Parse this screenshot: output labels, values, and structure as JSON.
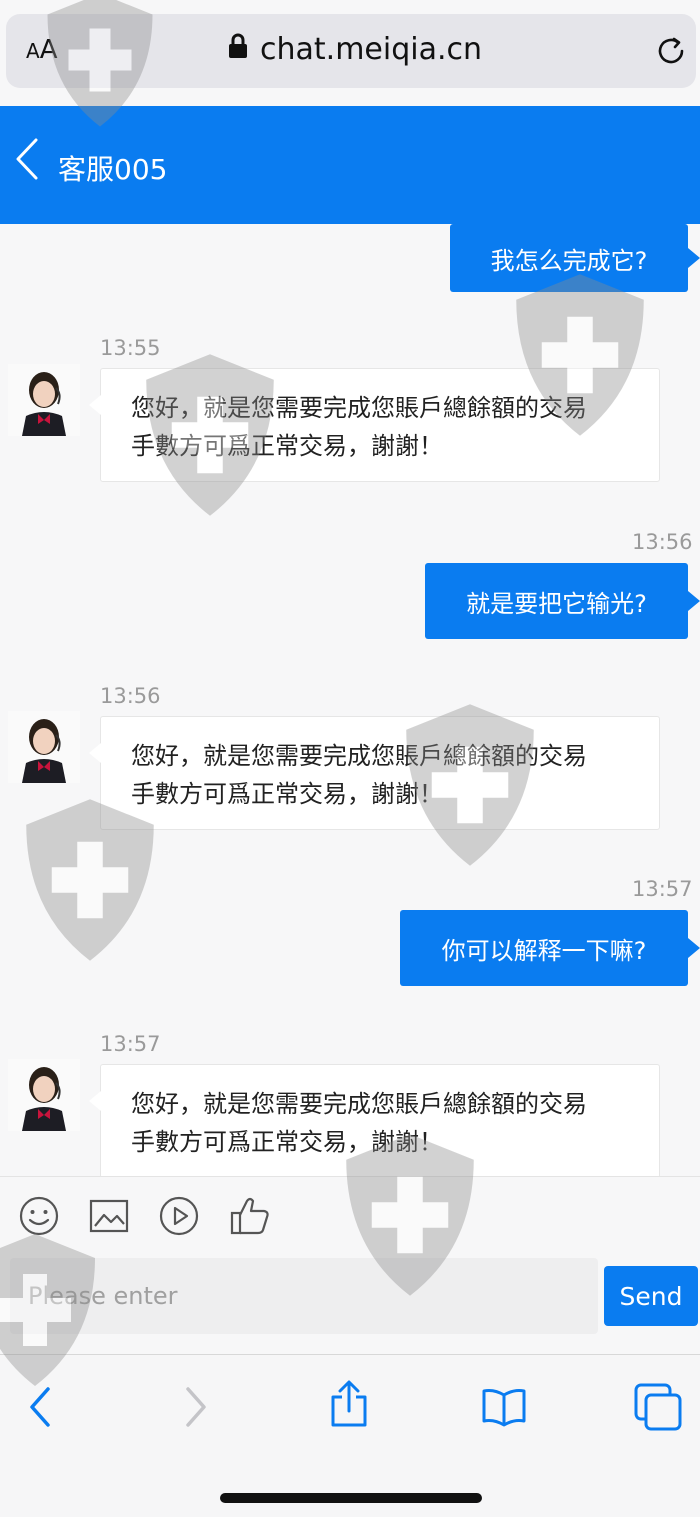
{
  "browser": {
    "text_size_label_small": "A",
    "text_size_label_large": "A",
    "url": "chat.meiqia.cn"
  },
  "header": {
    "title": "客服005"
  },
  "messages": [
    {
      "direction": "out",
      "text": "我怎么完成它?"
    },
    {
      "direction": "in",
      "time": "13:55",
      "lines": [
        "您好，就是您需要完成您賬戶總餘額的交易",
        "手數方可爲正常交易，謝謝！"
      ]
    },
    {
      "direction": "out",
      "time": "13:56",
      "text": "就是要把它输光?"
    },
    {
      "direction": "in",
      "time": "13:56",
      "lines": [
        "您好，就是您需要完成您賬戶總餘額的交易",
        "手數方可爲正常交易，謝謝！"
      ]
    },
    {
      "direction": "out",
      "time": "13:57",
      "text": "你可以解释一下嘛?"
    },
    {
      "direction": "in",
      "time": "13:57",
      "lines": [
        "您好，就是您需要完成您賬戶總餘額的交易",
        "手數方可爲正常交易，謝謝！"
      ]
    }
  ],
  "toolbar": {
    "icons": [
      "emoji-icon",
      "image-icon",
      "video-icon",
      "thumbs-up-icon"
    ]
  },
  "composer": {
    "placeholder": "Please enter",
    "send_label": "Send"
  },
  "colors": {
    "accent": "#0a7cf0",
    "page_bg": "#f7f7f8",
    "incoming_bubble": "#ffffff"
  }
}
